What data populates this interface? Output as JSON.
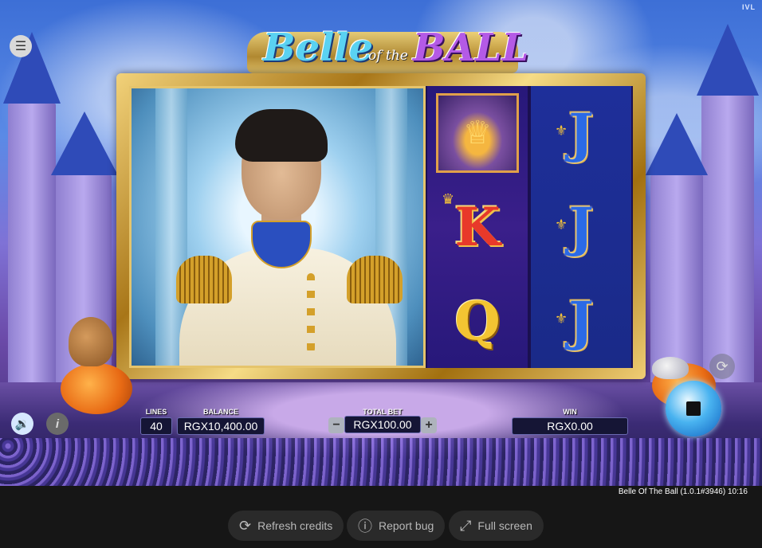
{
  "game": {
    "title_part1": "Belle",
    "title_part2": "of the",
    "title_part3": "BALL",
    "provider": "IVL"
  },
  "reels": {
    "reel4": [
      {
        "symbol": "carriage",
        "icon": "carriage-icon"
      },
      {
        "symbol": "K",
        "label": "K"
      },
      {
        "symbol": "Q",
        "label": "Q"
      }
    ],
    "reel5": [
      {
        "symbol": "J",
        "label": "J"
      },
      {
        "symbol": "J",
        "label": "J"
      },
      {
        "symbol": "J",
        "label": "J"
      }
    ]
  },
  "hud": {
    "lines_label": "LINES",
    "lines_value": "40",
    "balance_label": "BALANCE",
    "balance_value": "RGX10,400.00",
    "total_bet_label": "TOTAL BET",
    "total_bet_value": "RGX100.00",
    "minus": "−",
    "plus": "+",
    "win_label": "WIN",
    "win_value": "RGX0.00"
  },
  "footer": {
    "version": "Belle Of The Ball (1.0.1#3946) 10:16",
    "refresh_label": "Refresh credits",
    "report_label": "Report bug",
    "fullscreen_label": "Full screen"
  },
  "colors": {
    "frame_gold": "#d4a02a",
    "reel_bg": "#27187a",
    "spin_blue": "#49b3f0",
    "footer_bg": "#161616"
  }
}
